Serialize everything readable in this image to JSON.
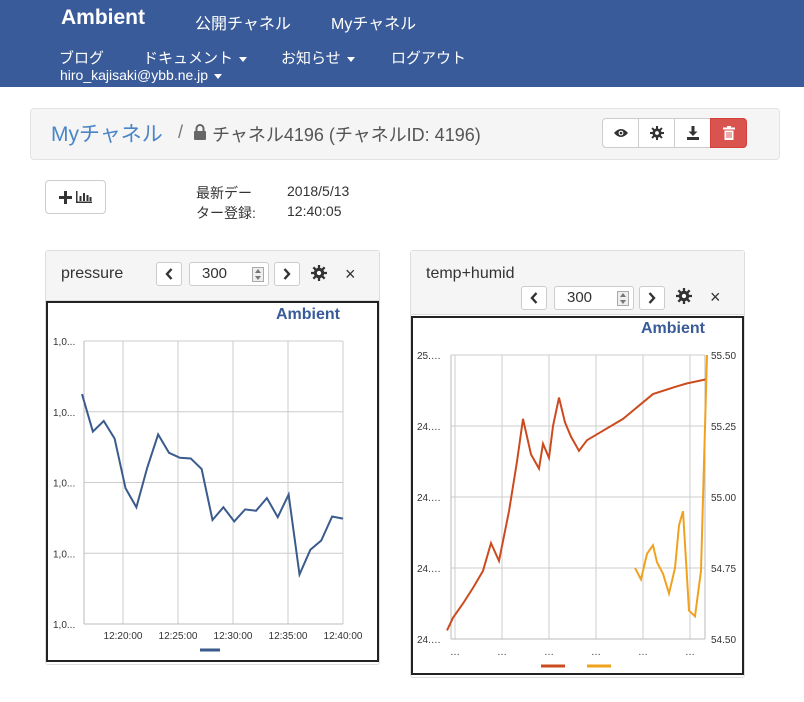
{
  "navbar": {
    "brand": "Ambient",
    "public_channels": "公開チャネル",
    "my_channels": "Myチャネル",
    "blog": "ブログ",
    "docs": "ドキュメント",
    "news": "お知らせ",
    "logout": "ログアウト",
    "user": "hiro_kajisaki@ybb.ne.jp"
  },
  "breadcrumb": {
    "link": "Myチャネル",
    "separator": "/",
    "title": "チャネル4196 (チャネルID: 4196)"
  },
  "info": {
    "label_line1": "最新デー",
    "label_line2": "ター登録:",
    "date": "2018/5/13",
    "time": "12:40:05"
  },
  "panels": [
    {
      "title": "pressure",
      "count": "300",
      "logo": "Ambient",
      "close": "×"
    },
    {
      "title": "temp+humid",
      "count": "300",
      "logo": "Ambient",
      "close": "×"
    }
  ],
  "chart_data": [
    {
      "type": "line",
      "x": [
        "12:17:30",
        "12:18:30",
        "12:19:30",
        "12:20:30",
        "12:21:30",
        "12:22:30",
        "12:23:30",
        "12:24:30",
        "12:25:30",
        "12:26:30",
        "12:27:30",
        "12:28:30",
        "12:29:30",
        "12:30:30",
        "12:31:30",
        "12:32:30",
        "12:33:30",
        "12:34:30",
        "12:35:30",
        "12:36:30",
        "12:37:30",
        "12:38:30",
        "12:39:30",
        "12:40:30"
      ],
      "y_tick_labels": [
        "1,0...",
        "1,0...",
        "1,0...",
        "1,0...",
        "1,0..."
      ],
      "x_tick_labels": [
        "12:20:00",
        "12:25:00",
        "12:30:00",
        "12:35:00",
        "12:40:00"
      ],
      "series": [
        {
          "color": "#3a5b8c",
          "values": [
            3.25,
            2.72,
            2.87,
            2.62,
            1.92,
            1.65,
            2.21,
            2.68,
            2.42,
            2.35,
            2.34,
            2.19,
            1.47,
            1.65,
            1.45,
            1.62,
            1.6,
            1.78,
            1.51,
            1.83,
            0.7,
            1.05,
            1.18,
            1.52,
            1.49
          ]
        }
      ],
      "grid": true
    },
    {
      "type": "line",
      "y_left_tick_labels": [
        "25.…",
        "24.…",
        "24.…",
        "24.…",
        "24.…"
      ],
      "y_right_tick_labels": [
        "55.50",
        "55.25",
        "55.00",
        "54.75",
        "54.50"
      ],
      "x_tick_labels": [
        "…",
        "…",
        "…",
        "…",
        "…",
        "…"
      ],
      "series": [
        {
          "color": "#cc4b1e",
          "axis": "left",
          "values": [
            0.12,
            0.3,
            0.5,
            0.72,
            0.96,
            1.35,
            1.1,
            1.8,
            2.5,
            3.1,
            2.6,
            2.4,
            2.75,
            2.55,
            3.0,
            3.4,
            3.05,
            2.85,
            2.65,
            2.8,
            3.1,
            3.45,
            3.55,
            3.6,
            3.66
          ]
        },
        {
          "color": "#f0a21e",
          "axis": "right",
          "values": [
            54.75,
            54.71,
            54.8,
            54.83,
            54.77,
            54.73,
            54.66,
            54.75,
            54.9,
            54.95,
            54.6,
            54.58,
            54.74,
            55.5
          ]
        }
      ],
      "grid": true
    }
  ]
}
